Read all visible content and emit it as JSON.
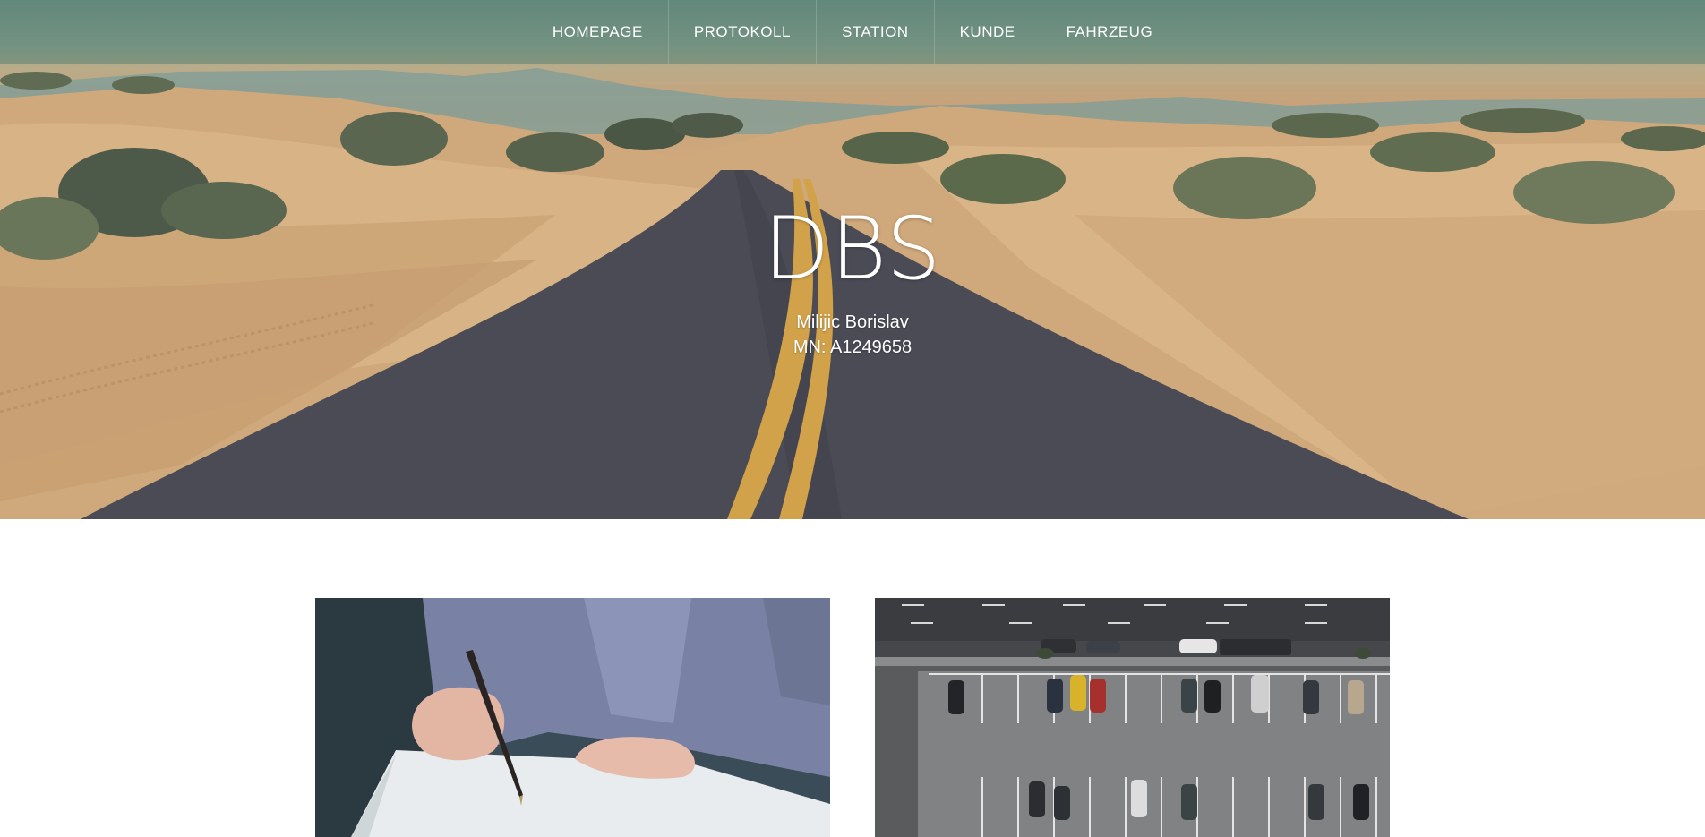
{
  "nav": {
    "items": [
      {
        "label": "HOMEPAGE"
      },
      {
        "label": "PROTOKOLL"
      },
      {
        "label": "STATION"
      },
      {
        "label": "KUNDE"
      },
      {
        "label": "FAHRZEUG"
      }
    ]
  },
  "hero": {
    "title": "DBS",
    "name": "Milijic Borislav",
    "mn": "MN: A1249658"
  },
  "cards": [
    {
      "image": "person-signing-document"
    },
    {
      "image": "parking-lot-aerial"
    }
  ]
}
